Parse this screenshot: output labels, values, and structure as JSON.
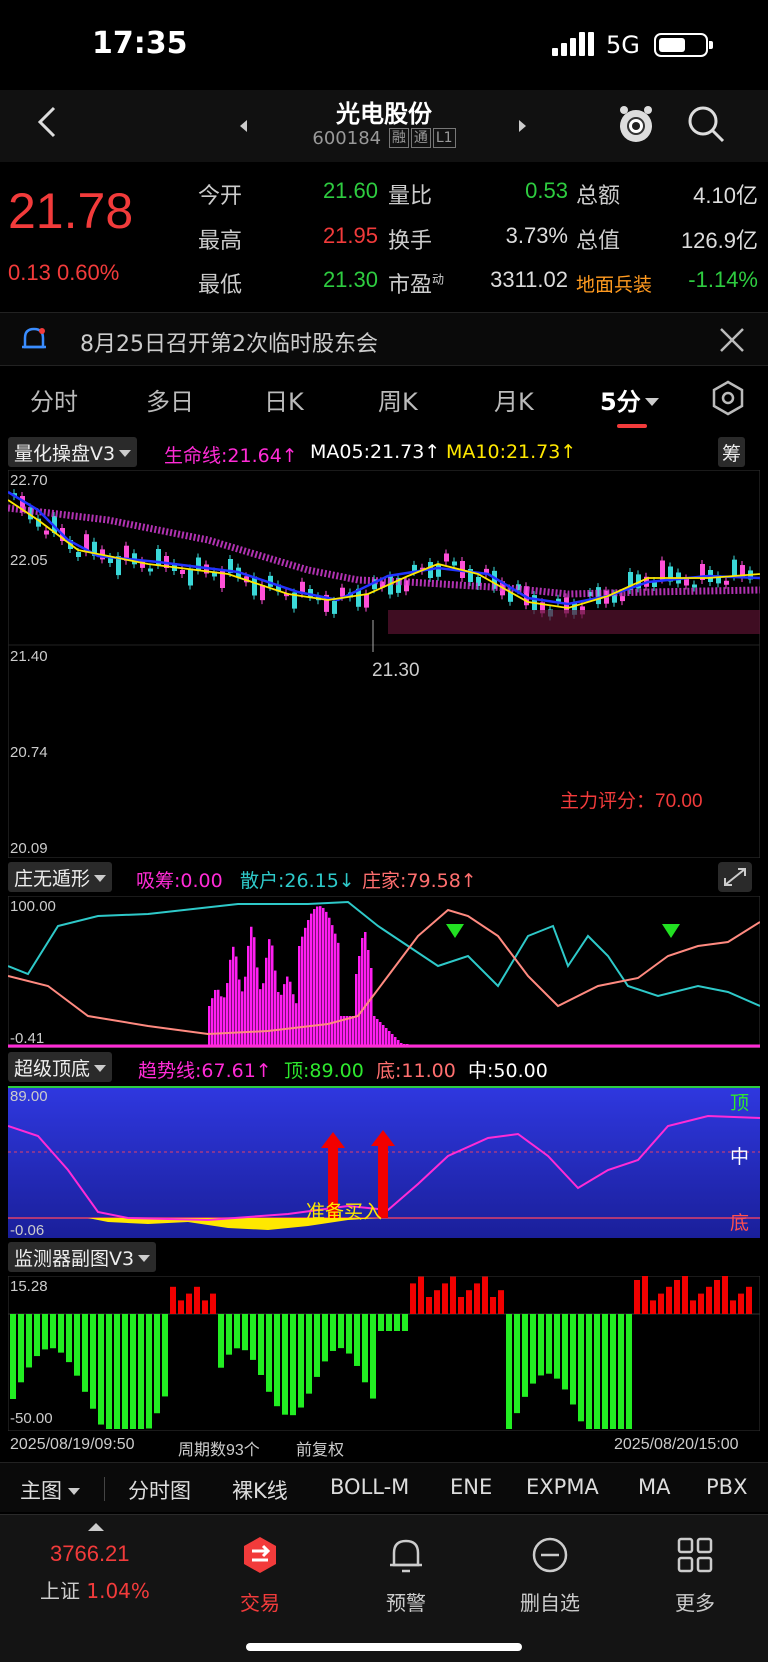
{
  "status": {
    "time": "17:35",
    "network": "5G"
  },
  "header": {
    "name": "光电股份",
    "code": "600184",
    "tags": [
      "融",
      "通",
      "L1"
    ]
  },
  "quote": {
    "price": "21.78",
    "change": "0.13",
    "change_pct": "0.60%",
    "rows": [
      [
        {
          "label": "今开",
          "value": "21.60",
          "color": "green"
        },
        {
          "label": "量比",
          "value": "0.53",
          "color": "green"
        },
        {
          "label": "总额",
          "value": "4.10亿",
          "color": "white"
        }
      ],
      [
        {
          "label": "最高",
          "value": "21.95",
          "color": "red"
        },
        {
          "label": "换手",
          "value": "3.73%",
          "color": "white"
        },
        {
          "label": "总值",
          "value": "126.9亿",
          "color": "white"
        }
      ],
      [
        {
          "label": "最低",
          "value": "21.30",
          "color": "green"
        },
        {
          "label": "市盈",
          "label_sup": "动",
          "value": "3311.02",
          "color": "white"
        },
        {
          "label": "地面兵装",
          "value": "-1.14%",
          "color": "green"
        }
      ]
    ]
  },
  "notice": {
    "text": "8月25日召开第2次临时股东会"
  },
  "tabs": [
    "分时",
    "多日",
    "日K",
    "周K",
    "月K",
    "5分"
  ],
  "active_tab": "5分",
  "main_indicator": {
    "name": "量化操盘V3",
    "life_line": "生命线:21.64↑",
    "ma05": "MA05:21.73↑",
    "ma10": "MA10:21.73↑",
    "chip_label": "筹",
    "axis": [
      "22.70",
      "22.05",
      "21.40",
      "20.74",
      "20.09"
    ],
    "low_marker": "21.30",
    "score": "主力评分：70.00"
  },
  "sub1": {
    "name": "庄无遁形",
    "a": "吸筹:0.00",
    "b": "散户:26.15↓",
    "c": "庄家:79.58↑",
    "axis": [
      "100.00",
      "-0.41"
    ]
  },
  "sub2": {
    "name": "超级顶底",
    "trend": "趋势线:67.61↑",
    "top": "顶:89.00",
    "bottom": "底:11.00",
    "mid": "中:50.00",
    "axis": [
      "89.00",
      "-0.06"
    ],
    "right_labels": [
      "顶",
      "中",
      "底"
    ],
    "signal_text": "准备买入"
  },
  "sub3": {
    "name": "监测器副图V3",
    "axis": [
      "15.28",
      "-50.00"
    ]
  },
  "date_row": {
    "start": "2025/08/19/09:50",
    "periods": "周期数93个",
    "adjust": "前复权",
    "end": "2025/08/20/15:00"
  },
  "ind_tabs": [
    "主图",
    "分时图",
    "裸K线",
    "BOLL-M",
    "ENE",
    "EXPMA",
    "MA",
    "PBX"
  ],
  "bottom_nav": {
    "index_value": "3766.21",
    "index_name": "上证",
    "index_pct": "1.04%",
    "items": [
      "交易",
      "预警",
      "删自选",
      "更多"
    ]
  },
  "colors": {
    "up": "#f23b3b",
    "down": "#2ecc40",
    "magenta": "#ff2bd6",
    "cyan": "#2ec9c9",
    "yellow": "#ffe800",
    "blue_band": "#2d35d8"
  }
}
